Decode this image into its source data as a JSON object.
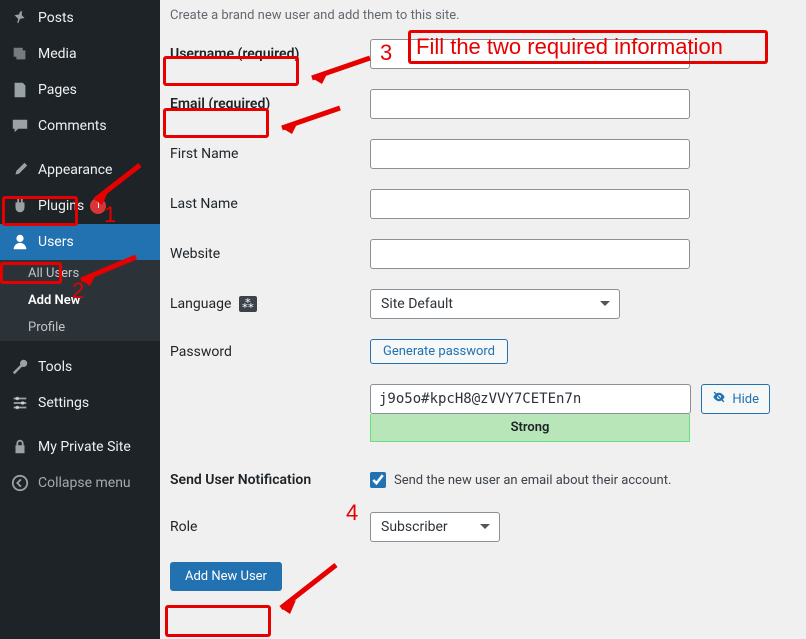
{
  "sidebar": {
    "items": [
      {
        "label": "Posts",
        "icon": "pin"
      },
      {
        "label": "Media",
        "icon": "media"
      },
      {
        "label": "Pages",
        "icon": "pages"
      },
      {
        "label": "Comments",
        "icon": "comments"
      },
      {
        "label": "Appearance",
        "icon": "brush"
      },
      {
        "label": "Plugins",
        "icon": "plugin",
        "badge": "1"
      },
      {
        "label": "Users",
        "icon": "user",
        "active": true
      },
      {
        "label": "Tools",
        "icon": "wrench"
      },
      {
        "label": "Settings",
        "icon": "sliders"
      },
      {
        "label": "My Private Site",
        "icon": "lock"
      },
      {
        "label": "Collapse menu",
        "icon": "collapse"
      }
    ],
    "submenu": {
      "items": [
        "All Users",
        "Add New",
        "Profile"
      ],
      "current": "Add New"
    }
  },
  "page": {
    "description": "Create a brand new user and add them to this site.",
    "fields": {
      "username_label": "Username (required)",
      "email_label": "Email (required)",
      "firstname_label": "First Name",
      "lastname_label": "Last Name",
      "website_label": "Website",
      "language_label": "Language",
      "language_value": "Site Default",
      "password_label": "Password",
      "generate_btn": "Generate password",
      "password_value": "j9o5o#kpcH8@zVVY7CETEn7n",
      "hide_btn": "Hide",
      "strength": "Strong",
      "notify_label": "Send User Notification",
      "notify_text": "Send the new user an email about their account.",
      "notify_checked": true,
      "role_label": "Role",
      "role_value": "Subscriber",
      "submit_btn": "Add New User"
    }
  },
  "annotations": {
    "step1": "1",
    "step2": "2",
    "step3": "3",
    "step4": "4",
    "instruction": "Fill the two required information"
  }
}
